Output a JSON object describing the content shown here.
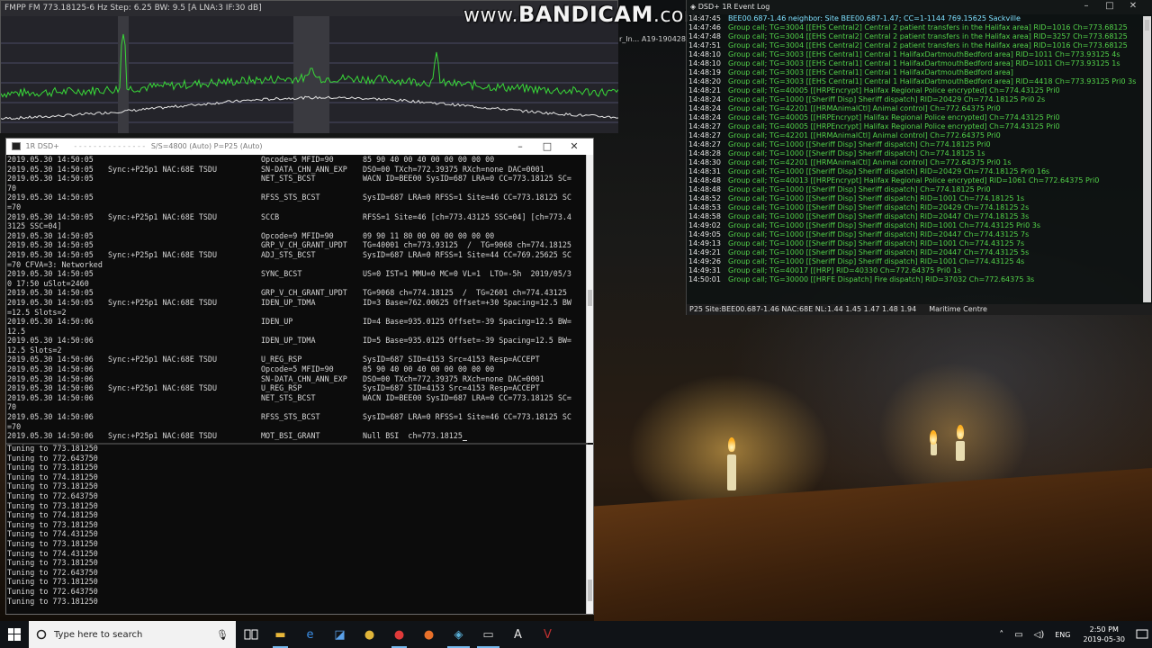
{
  "spectrum": {
    "title": "FMPP  FM 773.18125-6 Hz  Step: 6.25  BW: 9.5  [A  LNA:3  IF:30 dB]",
    "accent_color": "#38d838"
  },
  "watermark": {
    "prefix": "www.",
    "brand": "BANDICAM",
    "suffix": ".com"
  },
  "background_label": "r_In...  A19-190428...",
  "console": {
    "title": "1R DSD+",
    "title_status": "S/S=4800 (Auto) P=P25 (Auto)",
    "log_rows": [
      {
        "t": "2019.05.30 14:50:05",
        "sync": "",
        "op": "Opcode=5 MFID=90",
        "info": "85 90 40 00 40 00 00 00 00 00"
      },
      {
        "t": "2019.05.30 14:50:05",
        "sync": "Sync:+P25p1 NAC:68E TSDU",
        "op": "SN-DATA_CHN_ANN_EXP",
        "info": "DSO=00 TXch=772.39375 RXch=none DAC=0001"
      },
      {
        "t": "2019.05.30 14:50:05",
        "sync": "",
        "op": "NET_STS_BCST",
        "info": "WACN ID=BEE00 SysID=687 LRA=0 CC=773.18125 SC="
      },
      {
        "cont": "70"
      },
      {
        "t": "2019.05.30 14:50:05",
        "sync": "",
        "op": "RFSS_STS_BCST",
        "info": "SysID=687 LRA=0 RFSS=1 Site=46 CC=773.18125 SC"
      },
      {
        "cont": "=70"
      },
      {
        "t": "2019.05.30 14:50:05",
        "sync": "Sync:+P25p1 NAC:68E TSDU",
        "op": "SCCB",
        "info": "RFSS=1 Site=46 [ch=773.43125 SSC=04] [ch=773.4"
      },
      {
        "cont": "3125 SSC=04]"
      },
      {
        "t": "2019.05.30 14:50:05",
        "sync": "",
        "op": "Opcode=9 MFID=90",
        "info": "09 90 11 80 00 00 00 00 00 00"
      },
      {
        "t": "2019.05.30 14:50:05",
        "sync": "",
        "op": "GRP_V_CH_GRANT_UPDT",
        "info": "TG=40001 ch=773.93125  /  TG=9068 ch=774.18125"
      },
      {
        "t": "2019.05.30 14:50:05",
        "sync": "Sync:+P25p1 NAC:68E TSDU",
        "op": "ADJ_STS_BCST",
        "info": "SysID=687 LRA=0 RFSS=1 Site=44 CC=769.25625 SC"
      },
      {
        "cont": "=70 CFVA=3: Networked"
      },
      {
        "t": "2019.05.30 14:50:05",
        "sync": "",
        "op": "SYNC_BCST",
        "info": "US=0 IST=1 MMU=0 MC=0 VL=1  LTO=-5h  2019/05/3"
      },
      {
        "cont": "0 17:50 uSlot=2460"
      },
      {
        "t": "2019.05.30 14:50:05",
        "sync": "",
        "op": "GRP_V_CH_GRANT_UPDT",
        "info": "TG=9068 ch=774.18125  /  TG=2601 ch=774.43125"
      },
      {
        "t": "2019.05.30 14:50:05",
        "sync": "Sync:+P25p1 NAC:68E TSDU",
        "op": "IDEN_UP_TDMA",
        "info": "ID=3 Base=762.00625 Offset=+30 Spacing=12.5 BW"
      },
      {
        "cont": "=12.5 Slots=2"
      },
      {
        "t": "2019.05.30 14:50:06",
        "sync": "",
        "op": "IDEN_UP",
        "info": "ID=4 Base=935.0125 Offset=-39 Spacing=12.5 BW="
      },
      {
        "cont": "12.5"
      },
      {
        "t": "2019.05.30 14:50:06",
        "sync": "",
        "op": "IDEN_UP_TDMA",
        "info": "ID=5 Base=935.0125 Offset=-39 Spacing=12.5 BW="
      },
      {
        "cont": "12.5 Slots=2"
      },
      {
        "t": "2019.05.30 14:50:06",
        "sync": "Sync:+P25p1 NAC:68E TSDU",
        "op": "U_REG_RSP",
        "info": "SysID=687 SID=4153 Src=4153 Resp=ACCEPT"
      },
      {
        "t": "2019.05.30 14:50:06",
        "sync": "",
        "op": "Opcode=5 MFID=90",
        "info": "05 90 40 00 40 00 00 00 00 00"
      },
      {
        "t": "2019.05.30 14:50:06",
        "sync": "",
        "op": "SN-DATA_CHN_ANN_EXP",
        "info": "DSO=00 TXch=772.39375 RXch=none DAC=0001"
      },
      {
        "t": "2019.05.30 14:50:06",
        "sync": "Sync:+P25p1 NAC:68E TSDU",
        "op": "U_REG_RSP",
        "info": "SysID=687 SID=4153 Src=4153 Resp=ACCEPT"
      },
      {
        "t": "2019.05.30 14:50:06",
        "sync": "",
        "op": "NET_STS_BCST",
        "info": "WACN ID=BEE00 SysID=687 LRA=0 CC=773.18125 SC="
      },
      {
        "cont": "70"
      },
      {
        "t": "2019.05.30 14:50:06",
        "sync": "",
        "op": "RFSS_STS_BCST",
        "info": "SysID=687 LRA=0 RFSS=1 Site=46 CC=773.18125 SC"
      },
      {
        "cont": "=70"
      },
      {
        "t": "2019.05.30 14:50:06",
        "sync": "Sync:+P25p1 NAC:68E TSDU",
        "op": "MOT_BSI_GRANT",
        "info": "Null BSI  ch=773.18125",
        "cursor": true
      }
    ],
    "tuning_rows": [
      "Tuning to 773.181250",
      "Tuning to 772.643750",
      "Tuning to 773.181250",
      "Tuning to 774.181250",
      "Tuning to 773.181250",
      "Tuning to 772.643750",
      "Tuning to 773.181250",
      "Tuning to 774.181250",
      "Tuning to 773.181250",
      "Tuning to 774.431250",
      "Tuning to 773.181250",
      "Tuning to 774.431250",
      "Tuning to 773.181250",
      "Tuning to 772.643750",
      "Tuning to 773.181250",
      "Tuning to 772.643750",
      "Tuning to 773.181250"
    ]
  },
  "event_log": {
    "title": "DSD+ 1R Event Log",
    "rows": [
      {
        "t": "14:47:45",
        "m": "BEE00.687-1.46 neighbor:  Site BEE00.687-1.47; CC=1-1144  769.15625  Sackville",
        "first": true
      },
      {
        "t": "14:47:46",
        "m": "Group call; TG=3004 [[EHS Central2] Central 2  patient transfers in the Halifax area]  RID=1016  Ch=773.68125"
      },
      {
        "t": "14:47:48",
        "m": "Group call; TG=3004 [[EHS Central2] Central 2  patient transfers in the Halifax area]  RID=3257  Ch=773.68125"
      },
      {
        "t": "14:47:51",
        "m": "Group call; TG=3004 [[EHS Central2] Central 2  patient transfers in the Halifax area]  RID=1016  Ch=773.68125"
      },
      {
        "t": "14:48:10",
        "m": "Group call; TG=3003 [[EHS Central1] Central 1  HalifaxDartmouthBedford area]  RID=1011  Ch=773.93125  4s"
      },
      {
        "t": "14:48:10",
        "m": "Group call; TG=3003 [[EHS Central1] Central 1  HalifaxDartmouthBedford area]  RID=1011  Ch=773.93125  1s"
      },
      {
        "t": "14:48:19",
        "m": "Group call; TG=3003 [[EHS Central1] Central 1  HalifaxDartmouthBedford area]"
      },
      {
        "t": "14:48:20",
        "m": "Group call; TG=3003 [[EHS Central1] Central 1  HalifaxDartmouthBedford area]  RID=4418  Ch=773.93125 Pri0  3s"
      },
      {
        "t": "14:48:21",
        "m": "Group call; TG=40005 [[HRPEncrypt] Halifax Regional Police  encrypted]  Ch=774.43125 Pri0"
      },
      {
        "t": "14:48:24",
        "m": "Group call; TG=1000 [[Sheriff Disp] Sheriff dispatch]  RID=20429  Ch=774.18125 Pri0  2s"
      },
      {
        "t": "14:48:24",
        "m": "Group call; TG=42201 [[HRMAnimalCtl] Animal control]  Ch=772.64375 Pri0"
      },
      {
        "t": "14:48:24",
        "m": "Group call; TG=40005 [[HRPEncrypt] Halifax Regional Police  encrypted]  Ch=774.43125 Pri0"
      },
      {
        "t": "14:48:27",
        "m": "Group call; TG=40005 [[HRPEncrypt] Halifax Regional Police  encrypted]  Ch=774.43125 Pri0"
      },
      {
        "t": "14:48:27",
        "m": "Group call; TG=42201 [[HRMAnimalCtl] Animal control]  Ch=772.64375 Pri0"
      },
      {
        "t": "14:48:27",
        "m": "Group call; TG=1000 [[Sheriff Disp] Sheriff dispatch]  Ch=774.18125 Pri0"
      },
      {
        "t": "14:48:28",
        "m": "Group call; TG=1000 [[Sheriff Disp] Sheriff dispatch]  Ch=774.18125  1s"
      },
      {
        "t": "14:48:30",
        "m": "Group call; TG=42201 [[HRMAnimalCtl] Animal control]  Ch=772.64375 Pri0  1s"
      },
      {
        "t": "14:48:31",
        "m": "Group call; TG=1000 [[Sheriff Disp] Sheriff dispatch]  RID=20429  Ch=774.18125 Pri0  16s"
      },
      {
        "t": "14:48:48",
        "m": "Group call; TG=40013 [[HRPEncrypt] Halifax Regional Police  encrypted]  RID=1061  Ch=772.64375 Pri0"
      },
      {
        "t": "14:48:48",
        "m": "Group call; TG=1000 [[Sheriff Disp] Sheriff dispatch]  Ch=774.18125 Pri0"
      },
      {
        "t": "14:48:52",
        "m": "Group call; TG=1000 [[Sheriff Disp] Sheriff dispatch]  RID=1001  Ch=774.18125  1s"
      },
      {
        "t": "14:48:53",
        "m": "Group call; TG=1000 [[Sheriff Disp] Sheriff dispatch]  RID=20429  Ch=774.18125  2s"
      },
      {
        "t": "14:48:58",
        "m": "Group call; TG=1000 [[Sheriff Disp] Sheriff dispatch]  RID=20447  Ch=774.18125  3s"
      },
      {
        "t": "14:49:02",
        "m": "Group call; TG=1000 [[Sheriff Disp] Sheriff dispatch]  RID=1001  Ch=774.43125 Pri0  3s"
      },
      {
        "t": "14:49:05",
        "m": "Group call; TG=1000 [[Sheriff Disp] Sheriff dispatch]  RID=20447  Ch=774.43125  7s"
      },
      {
        "t": "14:49:13",
        "m": "Group call; TG=1000 [[Sheriff Disp] Sheriff dispatch]  RID=1001  Ch=774.43125  7s"
      },
      {
        "t": "14:49:21",
        "m": "Group call; TG=1000 [[Sheriff Disp] Sheriff dispatch]  RID=20447  Ch=774.43125  5s"
      },
      {
        "t": "14:49:26",
        "m": "Group call; TG=1000 [[Sheriff Disp] Sheriff dispatch]  RID=1001  Ch=774.43125  4s"
      },
      {
        "t": "14:49:31",
        "m": "Group call; TG=40017 [[HRP] RID=40330  Ch=772.64375 Pri0  1s"
      },
      {
        "t": "14:50:01",
        "m": "Group call; TG=30000 [[HRFE Dispatch] Fire dispatch]  RID=37032  Ch=772.64375  3s"
      }
    ],
    "status": "P25  Site:BEE00.687-1.46  NAC:68E  NL:1.44 1.45 1.47 1.48 1.94",
    "status_region": "Maritime Centre"
  },
  "taskbar": {
    "search_placeholder": "Type here to search",
    "apps": [
      {
        "icon": "file-explorer-icon",
        "glyph": "▬",
        "color": "#e8b73a",
        "state": "open"
      },
      {
        "icon": "edge-icon",
        "glyph": "e",
        "color": "#3b8ee6",
        "state": ""
      },
      {
        "icon": "photos-icon",
        "glyph": "◪",
        "color": "#5aa0e8",
        "state": ""
      },
      {
        "icon": "chrome-icon",
        "glyph": "●",
        "color": "#e0b53a",
        "state": ""
      },
      {
        "icon": "record-icon",
        "glyph": "●",
        "color": "#e03a3a",
        "state": "open"
      },
      {
        "icon": "firefox-icon",
        "glyph": "●",
        "color": "#e8702a",
        "state": ""
      },
      {
        "icon": "sdr-app-icon",
        "glyph": "◈",
        "color": "#5ab0d8",
        "state": "active"
      },
      {
        "icon": "console-icon",
        "glyph": "▭",
        "color": "#cfcfcf",
        "state": "active"
      },
      {
        "icon": "text-editor-icon",
        "glyph": "A",
        "color": "#e6e6e6",
        "state": ""
      },
      {
        "icon": "dsd-app-icon",
        "glyph": "V",
        "color": "#c03030",
        "state": ""
      }
    ],
    "tray_language": "ENG",
    "clock_time": "2:50 PM",
    "clock_date": "2019-05-30"
  }
}
